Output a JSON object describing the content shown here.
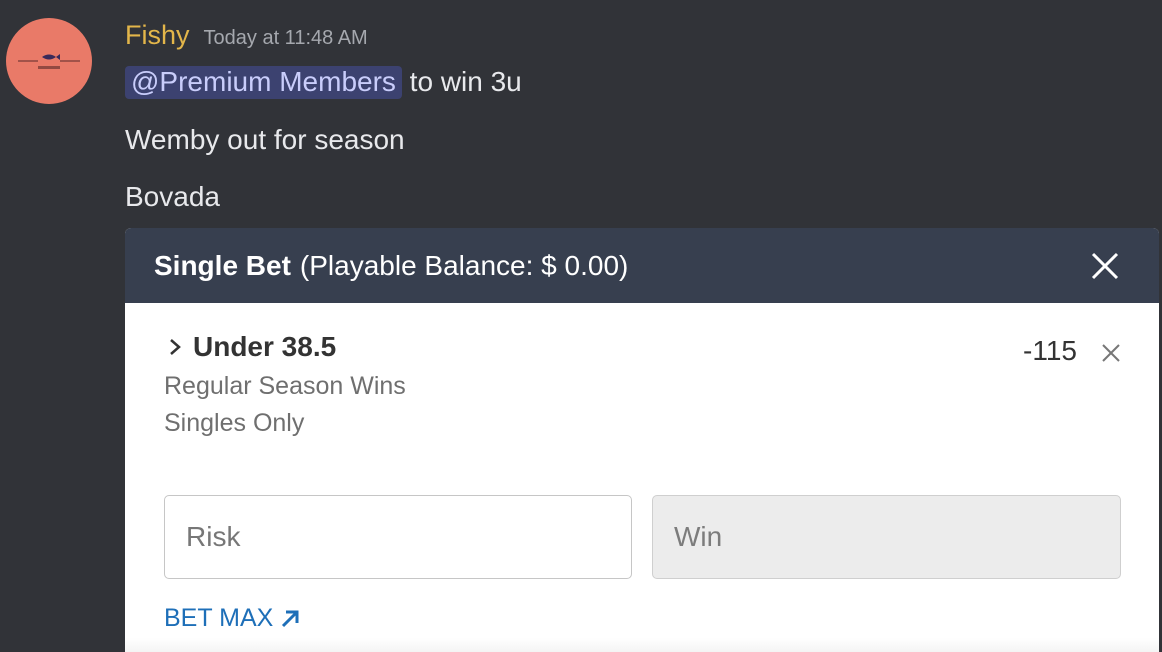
{
  "message": {
    "username": "Fishy",
    "timestamp": "Today at 11:48 AM",
    "mention": "@Premium Members",
    "line1_rest": " to win 3u",
    "line2": "Wemby out for season",
    "line3": "Bovada"
  },
  "bet_slip": {
    "title": "Single Bet",
    "balance": "(Playable Balance: $ 0.00)",
    "selection": {
      "title": "Under 38.5",
      "market": "Regular Season Wins",
      "restriction": "Singles Only",
      "odds": "-115"
    },
    "risk_placeholder": "Risk",
    "win_placeholder": "Win",
    "bet_max_label": "BET MAX"
  },
  "colors": {
    "background": "#313338",
    "username": "#e3b64a",
    "mention_bg": "#3c4270",
    "slip_header": "#373f4f",
    "link": "#1e6fb8",
    "avatar": "#e97a68"
  },
  "icons": {
    "avatar": "fish-logo-icon",
    "header_close": "close-icon",
    "selection_expand": "chevron-right-icon",
    "selection_remove": "close-icon",
    "bet_max": "arrow-up-right-icon"
  }
}
